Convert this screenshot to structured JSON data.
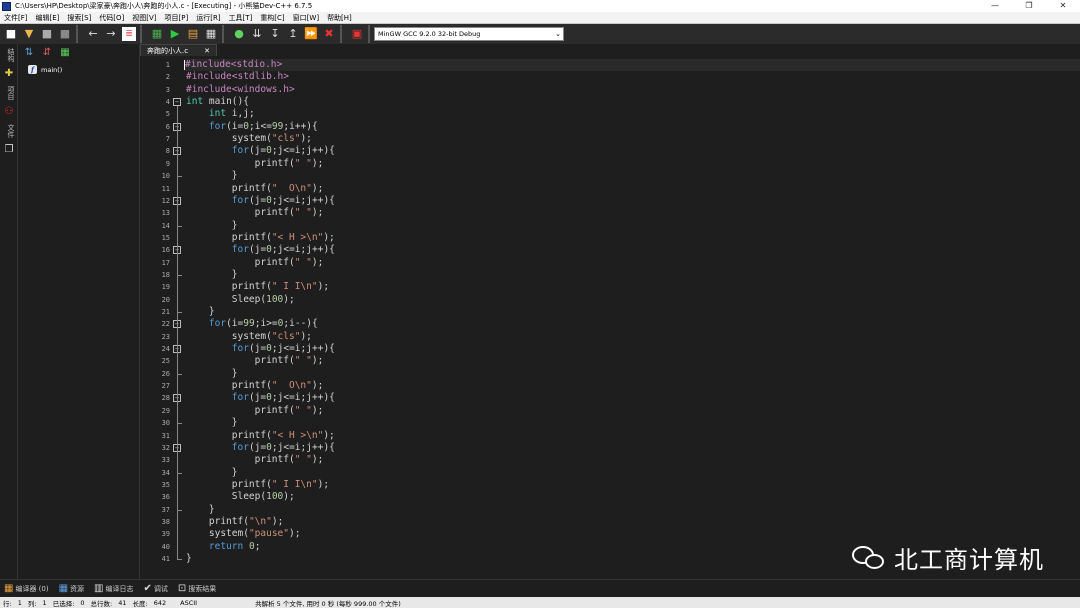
{
  "window": {
    "title": "C:\\Users\\HP\\Desktop\\梁家豪\\奔跑小人\\奔跑的小人.c - [Executing] - 小熊猫Dev-C++ 6.7.5",
    "controls": [
      "—",
      "❐",
      "✕"
    ]
  },
  "menu": [
    "文件[F]",
    "编辑[E]",
    "搜索[S]",
    "代码[O]",
    "视图[V]",
    "项目[P]",
    "运行[R]",
    "工具[T]",
    "重构[C]",
    "窗口[W]",
    "帮助[H]"
  ],
  "toolbar": {
    "compiler": "MinGW GCC 9.2.0 32-bit Debug"
  },
  "left_strip": {
    "tabs": [
      "结构",
      "项目",
      "文件"
    ]
  },
  "class_browser": {
    "items": [
      {
        "label": "main()"
      }
    ]
  },
  "editor_tabs": [
    {
      "label": "奔跑的小人.c",
      "close": "✕"
    }
  ],
  "editor": {
    "current_line": 1,
    "lines": [
      "#include<stdio.h>",
      "#include<stdlib.h>",
      "#include<windows.h>",
      "int main(){",
      "    int i,j;",
      "    for(i=0;i<=99;i++){",
      "        system(\"cls\");",
      "        for(j=0;j<=i;j++){",
      "            printf(\" \");",
      "        }",
      "        printf(\"  O\\n\");",
      "        for(j=0;j<=i;j++){",
      "            printf(\" \");",
      "        }",
      "        printf(\"< H >\\n\");",
      "        for(j=0;j<=i;j++){",
      "            printf(\" \");",
      "        }",
      "        printf(\" I I\\n\");",
      "        Sleep(100);",
      "    }",
      "    for(i=99;i>=0;i--){",
      "        system(\"cls\");",
      "        for(j=0;j<=i;j++){",
      "            printf(\" \");",
      "        }",
      "        printf(\"  O\\n\");",
      "        for(j=0;j<=i;j++){",
      "            printf(\" \");",
      "        }",
      "        printf(\"< H >\\n\");",
      "        for(j=0;j<=i;j++){",
      "            printf(\" \");",
      "        }",
      "        printf(\" I I\\n\");",
      "        Sleep(100);",
      "    }",
      "    printf(\"\\n\");",
      "    system(\"pause\");",
      "    return 0;",
      "}"
    ],
    "fold_starts": [
      4,
      6,
      8,
      12,
      16,
      22,
      24,
      28,
      32
    ]
  },
  "watermark": {
    "icon": "wechat-icon",
    "text": "北工商计算机"
  },
  "bottom_tabs": [
    {
      "icon": "compiler-icon",
      "label": "编译器 (0)"
    },
    {
      "icon": "resource-icon",
      "label": "资源"
    },
    {
      "icon": "compile-log-icon",
      "label": "编译日志"
    },
    {
      "icon": "debug-icon",
      "label": "调试"
    },
    {
      "icon": "search-results-icon",
      "label": "搜索结果"
    }
  ],
  "status": {
    "line_label": "行:",
    "line_value": "1",
    "col_label": "列:",
    "col_value": "1",
    "selected": "已选择:",
    "selected_value": "0",
    "total_lines_label": "总行数:",
    "total_lines_value": "41",
    "length_label": "长度:",
    "length_value": "642",
    "encoding": "ASCII",
    "parse_message": "共解析 5 个文件, 用时 0 秒 (每秒 999.00 个文件)"
  },
  "colors": {
    "preprocessor": "#c586c0",
    "keyword": "#569cd6",
    "type": "#4ec9b0",
    "string": "#ce9178",
    "number": "#b5cea8",
    "editor_bg": "#1e1e1e"
  }
}
